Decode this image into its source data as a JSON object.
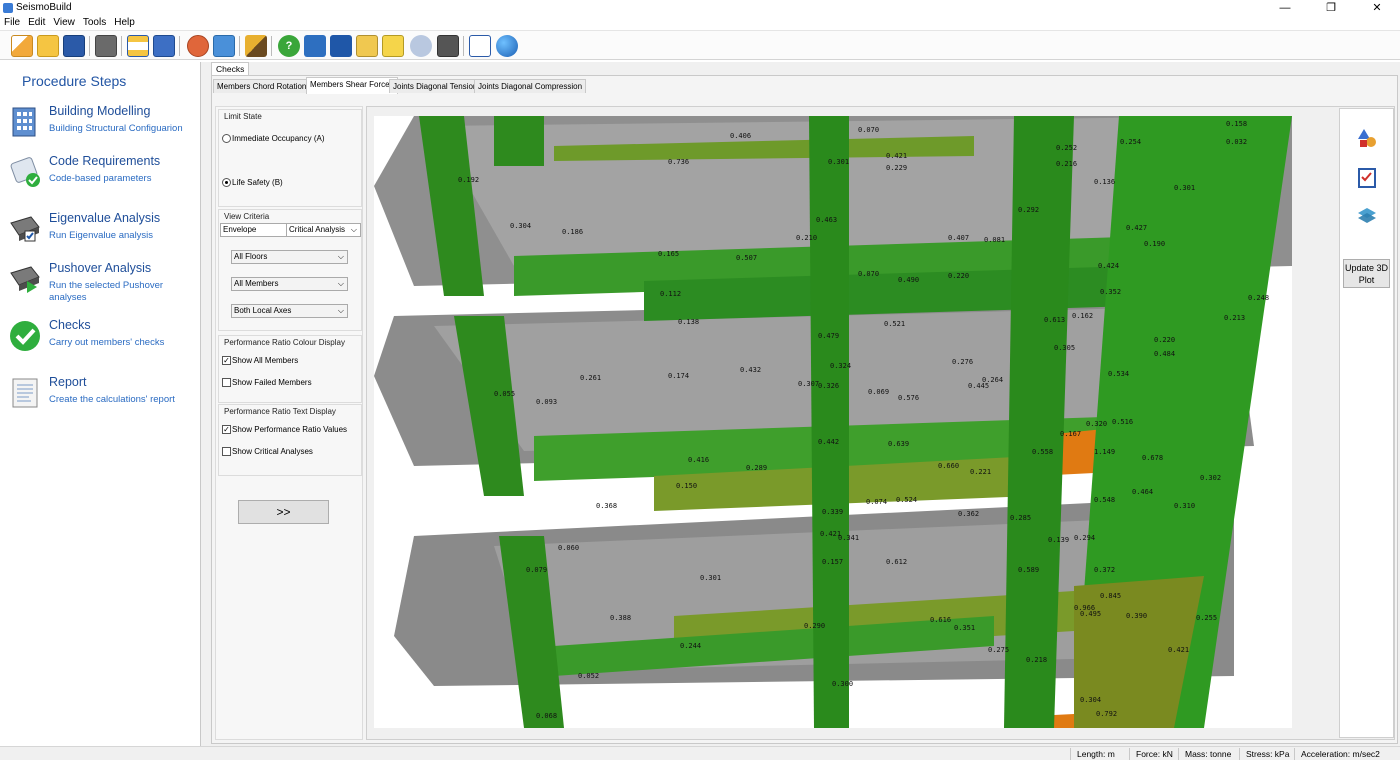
{
  "window": {
    "title": "SeismoBuild",
    "minimize": "—",
    "maximize": "❐",
    "close": "✕"
  },
  "menu": [
    "File",
    "Edit",
    "View",
    "Tools",
    "Help"
  ],
  "toolbar_icons": [
    "new-file-icon",
    "open-folder-icon",
    "save-icon",
    "structure-icon",
    "beam-icon",
    "report-doc-icon",
    "settings-gear-icon",
    "calculator-icon",
    "brush-icon",
    "help-icon",
    "book-icon",
    "book2-icon",
    "folder-note-icon",
    "folder-open-icon",
    "chat-icon",
    "film-icon",
    "edit-icon",
    "globe-icon"
  ],
  "procedure": {
    "title": "Procedure Steps",
    "steps": [
      {
        "title": "Building Modelling",
        "subtitle": "Building Structural Configuarion"
      },
      {
        "title": "Code Requirements",
        "subtitle": "Code-based parameters"
      },
      {
        "title": "Eigenvalue Analysis",
        "subtitle": "Run Eigenvalue analysis"
      },
      {
        "title": "Pushover Analysis",
        "subtitle": "Run the selected Pushover analyses"
      },
      {
        "title": "Checks",
        "subtitle": "Carry out members' checks"
      },
      {
        "title": "Report",
        "subtitle": "Create the calculations' report"
      }
    ]
  },
  "checks_tab": "Checks",
  "subtabs": [
    "Members Chord Rotations",
    "Members Shear Forces",
    "Joints Diagonal Tension",
    "Joints Diagonal Compression"
  ],
  "controls": {
    "limit_state_label": "Limit State",
    "limit_states": [
      "Immediate Occupancy (A)",
      "Life Safety (B)"
    ],
    "selected_limit_state": 1,
    "view_criteria_label": "View Criteria",
    "envelope": "Envelope",
    "critical_analysis": "Critical Analysis",
    "floors": "All Floors",
    "members": "All Members",
    "axes": "Both Local Axes",
    "colour_display_label": "Performance Ratio Colour Display",
    "show_all_members": "Show All Members",
    "show_all_members_checked": true,
    "show_failed_members": "Show Failed Members",
    "show_failed_members_checked": false,
    "text_display_label": "Performance Ratio Text Display",
    "show_ratio_values": "Show Performance Ratio Values",
    "show_ratio_values_checked": true,
    "show_critical": "Show Critical Analyses",
    "show_critical_checked": false,
    "go_button": ">>"
  },
  "update_button": "Update 3D Plot",
  "ratio_values": [
    "0.406",
    "0.070",
    "0.158",
    "0.736",
    "0.301",
    "0.421",
    "0.229",
    "0.252",
    "0.254",
    "0.032",
    "0.192",
    "0.216",
    "0.136",
    "0.301",
    "0.304",
    "0.186",
    "0.463",
    "0.210",
    "0.292",
    "0.427",
    "0.165",
    "0.507",
    "0.407",
    "0.081",
    "0.190",
    "0.424",
    "0.070",
    "0.490",
    "0.220",
    "0.112",
    "0.352",
    "0.248",
    "0.138",
    "0.521",
    "0.613",
    "0.162",
    "0.213",
    "0.479",
    "0.305",
    "0.220",
    "0.484",
    "0.324",
    "0.276",
    "0.261",
    "0.174",
    "0.432",
    "0.307",
    "0.326",
    "0.069",
    "0.576",
    "0.445",
    "0.264",
    "0.534",
    "0.055",
    "0.093",
    "0.320",
    "0.516",
    "0.167",
    "0.442",
    "0.639",
    "0.416",
    "0.289",
    "0.660",
    "0.221",
    "0.558",
    "1.149",
    "0.678",
    "0.302",
    "0.150",
    "0.464",
    "0.368",
    "0.339",
    "0.074",
    "0.524",
    "0.362",
    "0.548",
    "0.310",
    "0.285",
    "0.421",
    "0.341",
    "0.139",
    "0.294",
    "0.060",
    "0.157",
    "0.612",
    "0.589",
    "0.079",
    "0.301",
    "0.372",
    "0.845",
    "0.966",
    "0.495",
    "0.390",
    "0.255",
    "0.388",
    "0.290",
    "0.616",
    "0.351",
    "0.244",
    "0.275",
    "0.218",
    "0.421",
    "0.052",
    "0.300",
    "0.304",
    "0.792",
    "0.068"
  ],
  "status": {
    "length": "Length: m",
    "force": "Force: kN",
    "mass": "Mass: tonne",
    "stress": "Stress: kPa",
    "acceleration": "Acceleration: m/sec2"
  }
}
